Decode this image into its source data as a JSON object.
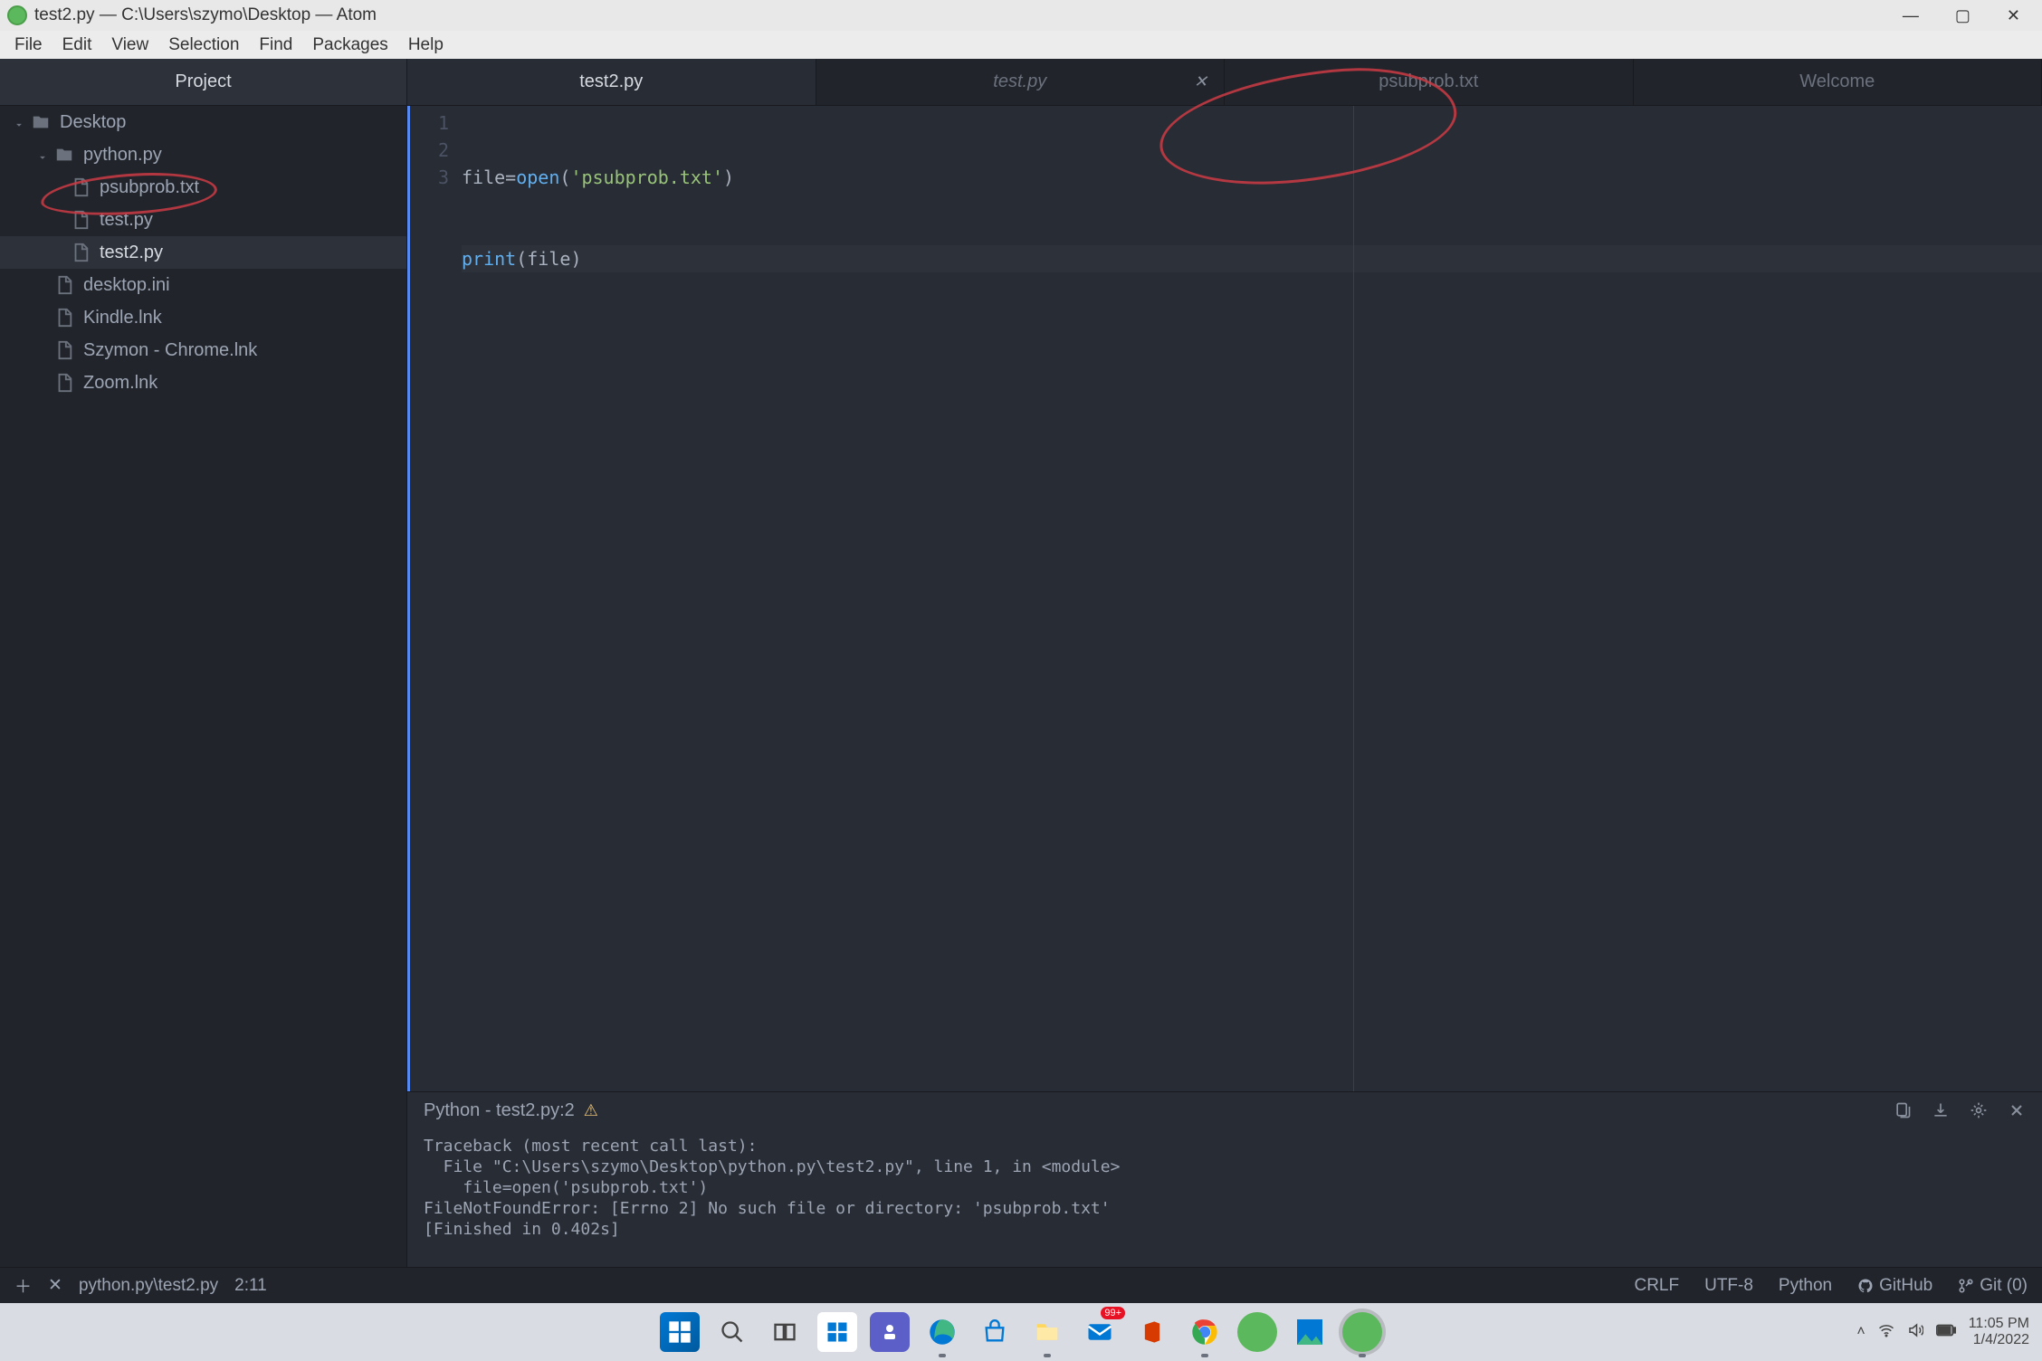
{
  "title_bar": {
    "title": "test2.py — C:\\Users\\szymo\\Desktop — Atom"
  },
  "menu": [
    "File",
    "Edit",
    "View",
    "Selection",
    "Find",
    "Packages",
    "Help"
  ],
  "sidebar": {
    "header": "Project",
    "items": [
      {
        "label": "Desktop",
        "type": "folder",
        "depth": "depth1",
        "chevron": true
      },
      {
        "label": "python.py",
        "type": "folder",
        "depth": "depth2",
        "chevron": true
      },
      {
        "label": "psubprob.txt",
        "type": "file",
        "depth": "depth3"
      },
      {
        "label": "test.py",
        "type": "file",
        "depth": "depth3"
      },
      {
        "label": "test2.py",
        "type": "file",
        "depth": "depth3",
        "active": true
      },
      {
        "label": "desktop.ini",
        "type": "file",
        "depth": "depth2b"
      },
      {
        "label": "Kindle.lnk",
        "type": "file",
        "depth": "depth2b"
      },
      {
        "label": "Szymon - Chrome.lnk",
        "type": "file",
        "depth": "depth2b"
      },
      {
        "label": "Zoom.lnk",
        "type": "file",
        "depth": "depth2b"
      }
    ]
  },
  "tabs": [
    {
      "label": "test2.py",
      "active": true
    },
    {
      "label": "test.py",
      "italic": true,
      "close": true
    },
    {
      "label": "psubprob.txt"
    },
    {
      "label": "Welcome"
    }
  ],
  "code": {
    "lines": [
      "1",
      "2",
      "3"
    ],
    "line1": {
      "a": "file",
      "b": "=",
      "c": "open",
      "d": "(",
      "e": "'psubprob.txt'",
      "f": ")"
    },
    "line2": {
      "a": "print",
      "b": "(",
      "c": "file",
      "d": ")"
    }
  },
  "output": {
    "header": "Python - test2.py:2",
    "body": "Traceback (most recent call last):\n  File \"C:\\Users\\szymo\\Desktop\\python.py\\test2.py\", line 1, in <module>\n    file=open('psubprob.txt')\nFileNotFoundError: [Errno 2] No such file or directory: 'psubprob.txt'\n[Finished in 0.402s]"
  },
  "status": {
    "path": "python.py\\test2.py",
    "cursor": "2:11",
    "encoding_eol": "CRLF",
    "encoding": "UTF-8",
    "lang": "Python",
    "github": "GitHub",
    "git": "Git (0)"
  },
  "tray": {
    "time": "11:05 PM",
    "date": "1/4/2022",
    "badge": "99+"
  }
}
